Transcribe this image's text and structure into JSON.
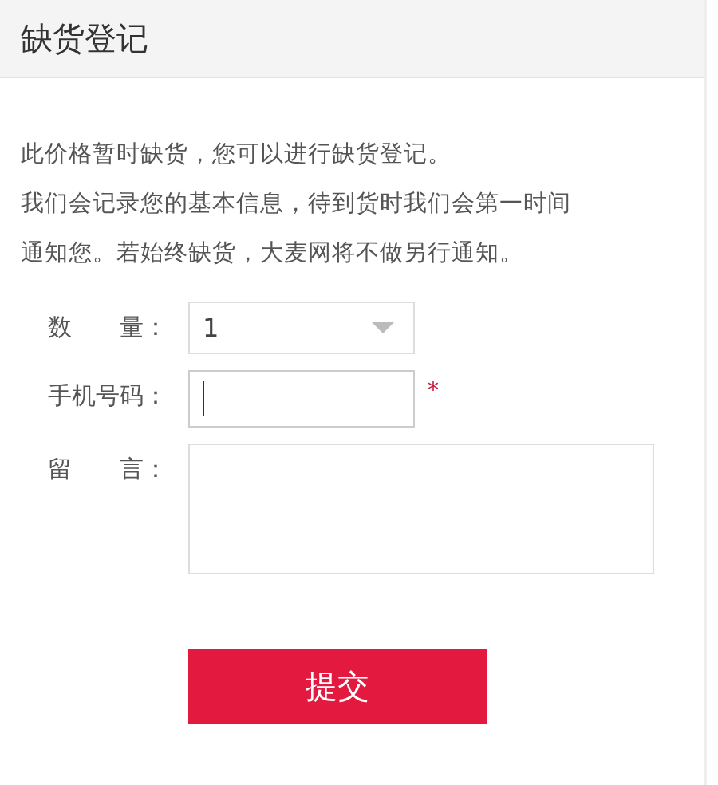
{
  "header": {
    "title": "缺货登记"
  },
  "notice": [
    "此价格暂时缺货，您可以进行缺货登记。",
    "我们会记录您的基本信息，待到货时我们会第一时间",
    "通知您。若始终缺货，大麦网将不做另行通知。"
  ],
  "fields": [
    {
      "kind": "select",
      "label": "数　　量：",
      "value": "1",
      "focused": false
    },
    {
      "kind": "text",
      "label": "手机号码：",
      "required_mark": "*",
      "focused": true
    },
    {
      "kind": "textarea",
      "label": "留　　言：",
      "focused": false
    }
  ],
  "submit": {
    "label": "提交"
  }
}
